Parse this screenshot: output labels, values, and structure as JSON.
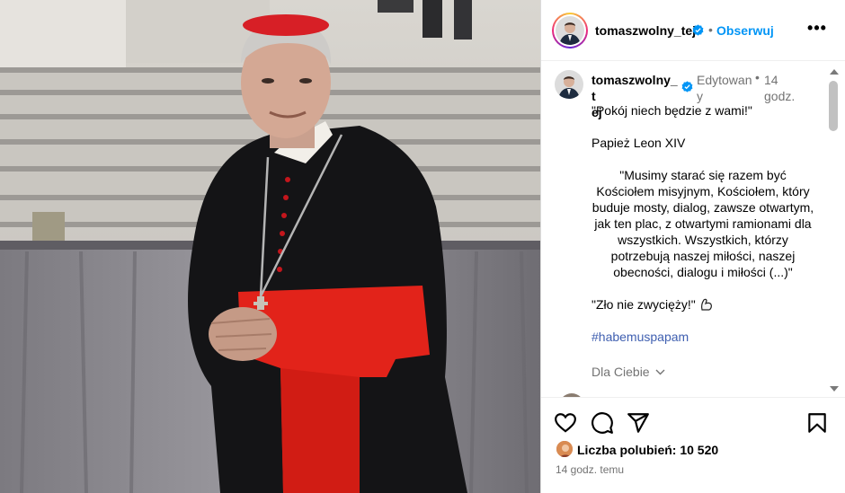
{
  "post": {
    "header": {
      "username": "tomaszwolny_tej",
      "separator": "•",
      "follow_label": "Obserwuj",
      "more_icon": "more-options-icon"
    },
    "caption": {
      "username_line1": "tomaszwolny_t",
      "username_line2": "ej",
      "edited_line1": "Edytowan",
      "edited_line2": "y",
      "separator": "•",
      "time_line1": "14",
      "time_line2": "godz.",
      "paragraphs": [
        "\"Pokój niech będzie z wami!\"",
        "Papież Leon XIV",
        "\"Musimy starać się razem być Kościołem misyjnym, Kościołem, który buduje mosty, dialog, zawsze otwartym, jak ten plac, z otwartymi ramionami dla wszystkich. Wszystkich, którzy potrzebują naszej miłości, naszej obecności, dialogu i miłości (...)\"",
        "\"Zło nie zwycięży!\""
      ],
      "hashtag": "#habemuspapam",
      "for_you": "Dla Ciebie"
    },
    "likes": {
      "text": "Liczba polubień: 10 520"
    },
    "time_ago": "14 godz. temu"
  },
  "colors": {
    "accent_blue": "#0095f6",
    "hashtag": "#3f5fb0",
    "secondary_text": "#737373",
    "border": "#dbdbdb"
  }
}
